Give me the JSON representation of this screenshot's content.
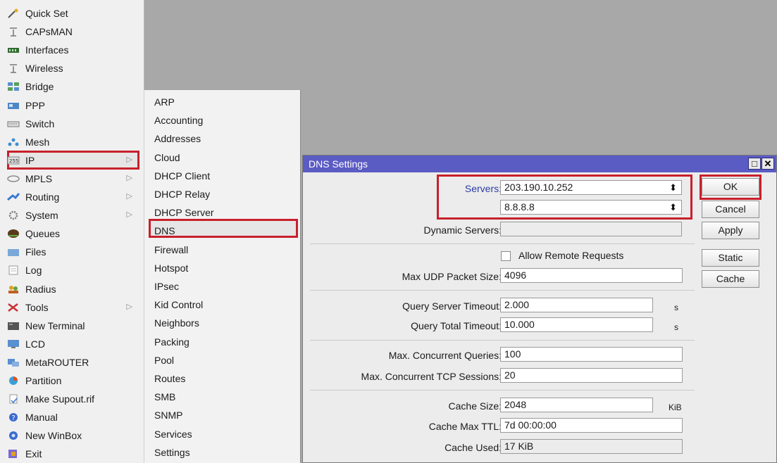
{
  "menu": {
    "items": [
      {
        "label": "Quick Set",
        "icon": "wizard-icon",
        "arrow": false
      },
      {
        "label": "CAPsMAN",
        "icon": "antenna-icon",
        "arrow": false
      },
      {
        "label": "Interfaces",
        "icon": "interfaces-icon",
        "arrow": false
      },
      {
        "label": "Wireless",
        "icon": "antenna-icon",
        "arrow": false
      },
      {
        "label": "Bridge",
        "icon": "bridge-icon",
        "arrow": false
      },
      {
        "label": "PPP",
        "icon": "ppp-icon",
        "arrow": false
      },
      {
        "label": "Switch",
        "icon": "switch-icon",
        "arrow": false
      },
      {
        "label": "Mesh",
        "icon": "mesh-icon",
        "arrow": false
      },
      {
        "label": "IP",
        "icon": "ip-icon",
        "arrow": true
      },
      {
        "label": "MPLS",
        "icon": "mpls-icon",
        "arrow": true
      },
      {
        "label": "Routing",
        "icon": "routing-icon",
        "arrow": true
      },
      {
        "label": "System",
        "icon": "gear-icon",
        "arrow": true
      },
      {
        "label": "Queues",
        "icon": "queues-icon",
        "arrow": false
      },
      {
        "label": "Files",
        "icon": "folder-icon",
        "arrow": false
      },
      {
        "label": "Log",
        "icon": "log-icon",
        "arrow": false
      },
      {
        "label": "Radius",
        "icon": "users-icon",
        "arrow": false
      },
      {
        "label": "Tools",
        "icon": "tools-icon",
        "arrow": true
      },
      {
        "label": "New Terminal",
        "icon": "terminal-icon",
        "arrow": false
      },
      {
        "label": "LCD",
        "icon": "monitor-icon",
        "arrow": false
      },
      {
        "label": "MetaROUTER",
        "icon": "metarouter-icon",
        "arrow": false
      },
      {
        "label": "Partition",
        "icon": "pie-icon",
        "arrow": false
      },
      {
        "label": "Make Supout.rif",
        "icon": "file-icon",
        "arrow": false
      },
      {
        "label": "Manual",
        "icon": "help-icon",
        "arrow": false
      },
      {
        "label": "New WinBox",
        "icon": "winbox-icon",
        "arrow": false
      },
      {
        "label": "Exit",
        "icon": "exit-icon",
        "arrow": false
      }
    ],
    "arrow_glyph": "▷"
  },
  "submenu": {
    "items": [
      "ARP",
      "Accounting",
      "Addresses",
      "Cloud",
      "DHCP Client",
      "DHCP Relay",
      "DHCP Server",
      "DNS",
      "Firewall",
      "Hotspot",
      "IPsec",
      "Kid Control",
      "Neighbors",
      "Packing",
      "Pool",
      "Routes",
      "SMB",
      "SNMP",
      "Services",
      "Settings"
    ]
  },
  "window": {
    "title": "DNS Settings",
    "servers_label": "Servers:",
    "server1": "203.190.10.252",
    "server2": "8.8.8.8",
    "dynamic_servers_label": "Dynamic Servers:",
    "dynamic_servers_value": "",
    "allow_remote_label": "Allow Remote Requests",
    "allow_remote_checked": false,
    "max_udp_label": "Max UDP Packet Size:",
    "max_udp_value": "4096",
    "query_server_timeout_label": "Query Server Timeout:",
    "query_server_timeout_value": "2.000",
    "query_total_timeout_label": "Query Total Timeout:",
    "query_total_timeout_value": "10.000",
    "seconds_unit": "s",
    "max_concurrent_queries_label": "Max. Concurrent Queries:",
    "max_concurrent_queries_value": "100",
    "max_concurrent_tcp_label": "Max. Concurrent TCP Sessions:",
    "max_concurrent_tcp_value": "20",
    "cache_size_label": "Cache Size:",
    "cache_size_value": "2048",
    "kib_unit": "KiB",
    "cache_max_ttl_label": "Cache Max TTL:",
    "cache_max_ttl_value": "7d 00:00:00",
    "cache_used_label": "Cache Used:",
    "cache_used_value": "17 KiB",
    "buttons": {
      "ok": "OK",
      "cancel": "Cancel",
      "apply": "Apply",
      "static": "Static",
      "cache": "Cache"
    },
    "updown_glyph": "⬍",
    "restore_glyph": "□",
    "close_glyph": "✕"
  },
  "colors": {
    "titlebar": "#5b5bc4",
    "highlight": "#c8202c",
    "desktop": "#a8a8a8"
  }
}
